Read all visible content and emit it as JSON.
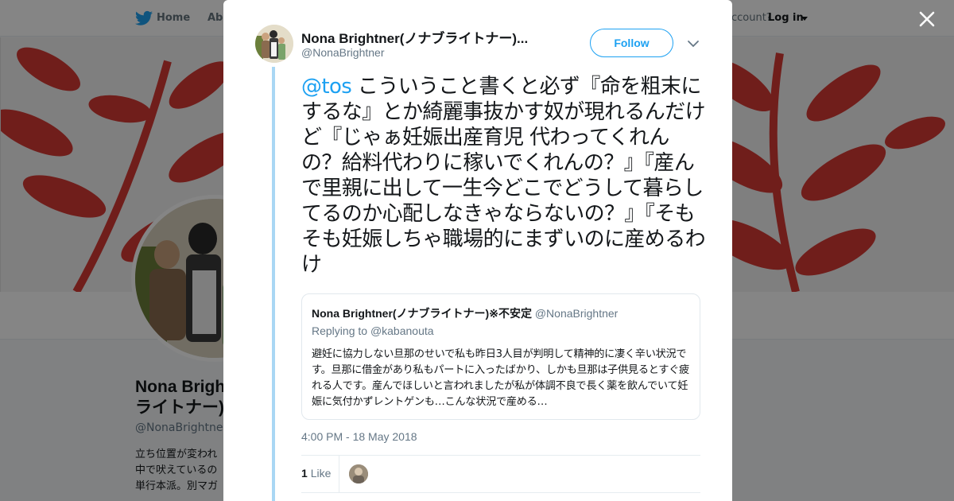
{
  "background_page": {
    "nav": {
      "home_label": "Home",
      "about_label": "Abo",
      "account_prompt": "account?",
      "login_label": "Log in"
    },
    "profile": {
      "name": "Nona Brightner(ノナブライトナー)※",
      "handle": "@NonaBrightner",
      "bio_lines": [
        "立ち位置が変われ",
        "中で吠えているの",
        "単行本派。別マガ"
      ]
    }
  },
  "tweet": {
    "author_name": "Nona Brightner(ノナブライトナー)...",
    "author_handle": "@NonaBrightner",
    "follow_label": "Follow",
    "mention": "@tos",
    "text": " こういうこと書くと必ず『命を粗末にするな』とか綺麗事抜かす奴が現れるんだけど『じゃぁ妊娠出産育児 代わってくれんの？給料代わりに稼いでくれんの？』『産んで里親に出して一生今どこでどうして暮らしてるのか心配しなきゃならないの？』『そもそも妊娠しちゃ職場的にまずいのに産めるわけ",
    "timestamp": "4:00 PM - 18 May 2018",
    "likes_count": "1",
    "likes_label": "Like"
  },
  "quoted_tweet": {
    "author_name": "Nona Brightner(ノナブライトナー)※不安定",
    "author_handle": "@NonaBrightner",
    "replying_to_prefix": "Replying to ",
    "replying_to": "@kabanouta",
    "text": "避妊に協力しない旦那のせいで私も昨日3人目が判明して精神的に凄く辛い状況です。旦那に借金があり私もパートに入ったばかり、しかも旦那は子供見るとすぐ疲れる人です。産んでほしいと言われましたが私が体調不良で長く薬を飲んでいて妊娠に気付かずレントゲンも…こんな状況で産める…"
  },
  "icons": {
    "bird": "twitter-bird-icon",
    "close": "close-icon",
    "caret": "chevron-down-icon"
  },
  "colors": {
    "brand_blue": "#1da1f2",
    "thread_line": "#a9d7f4",
    "banner_leaf": "#d63a35"
  }
}
